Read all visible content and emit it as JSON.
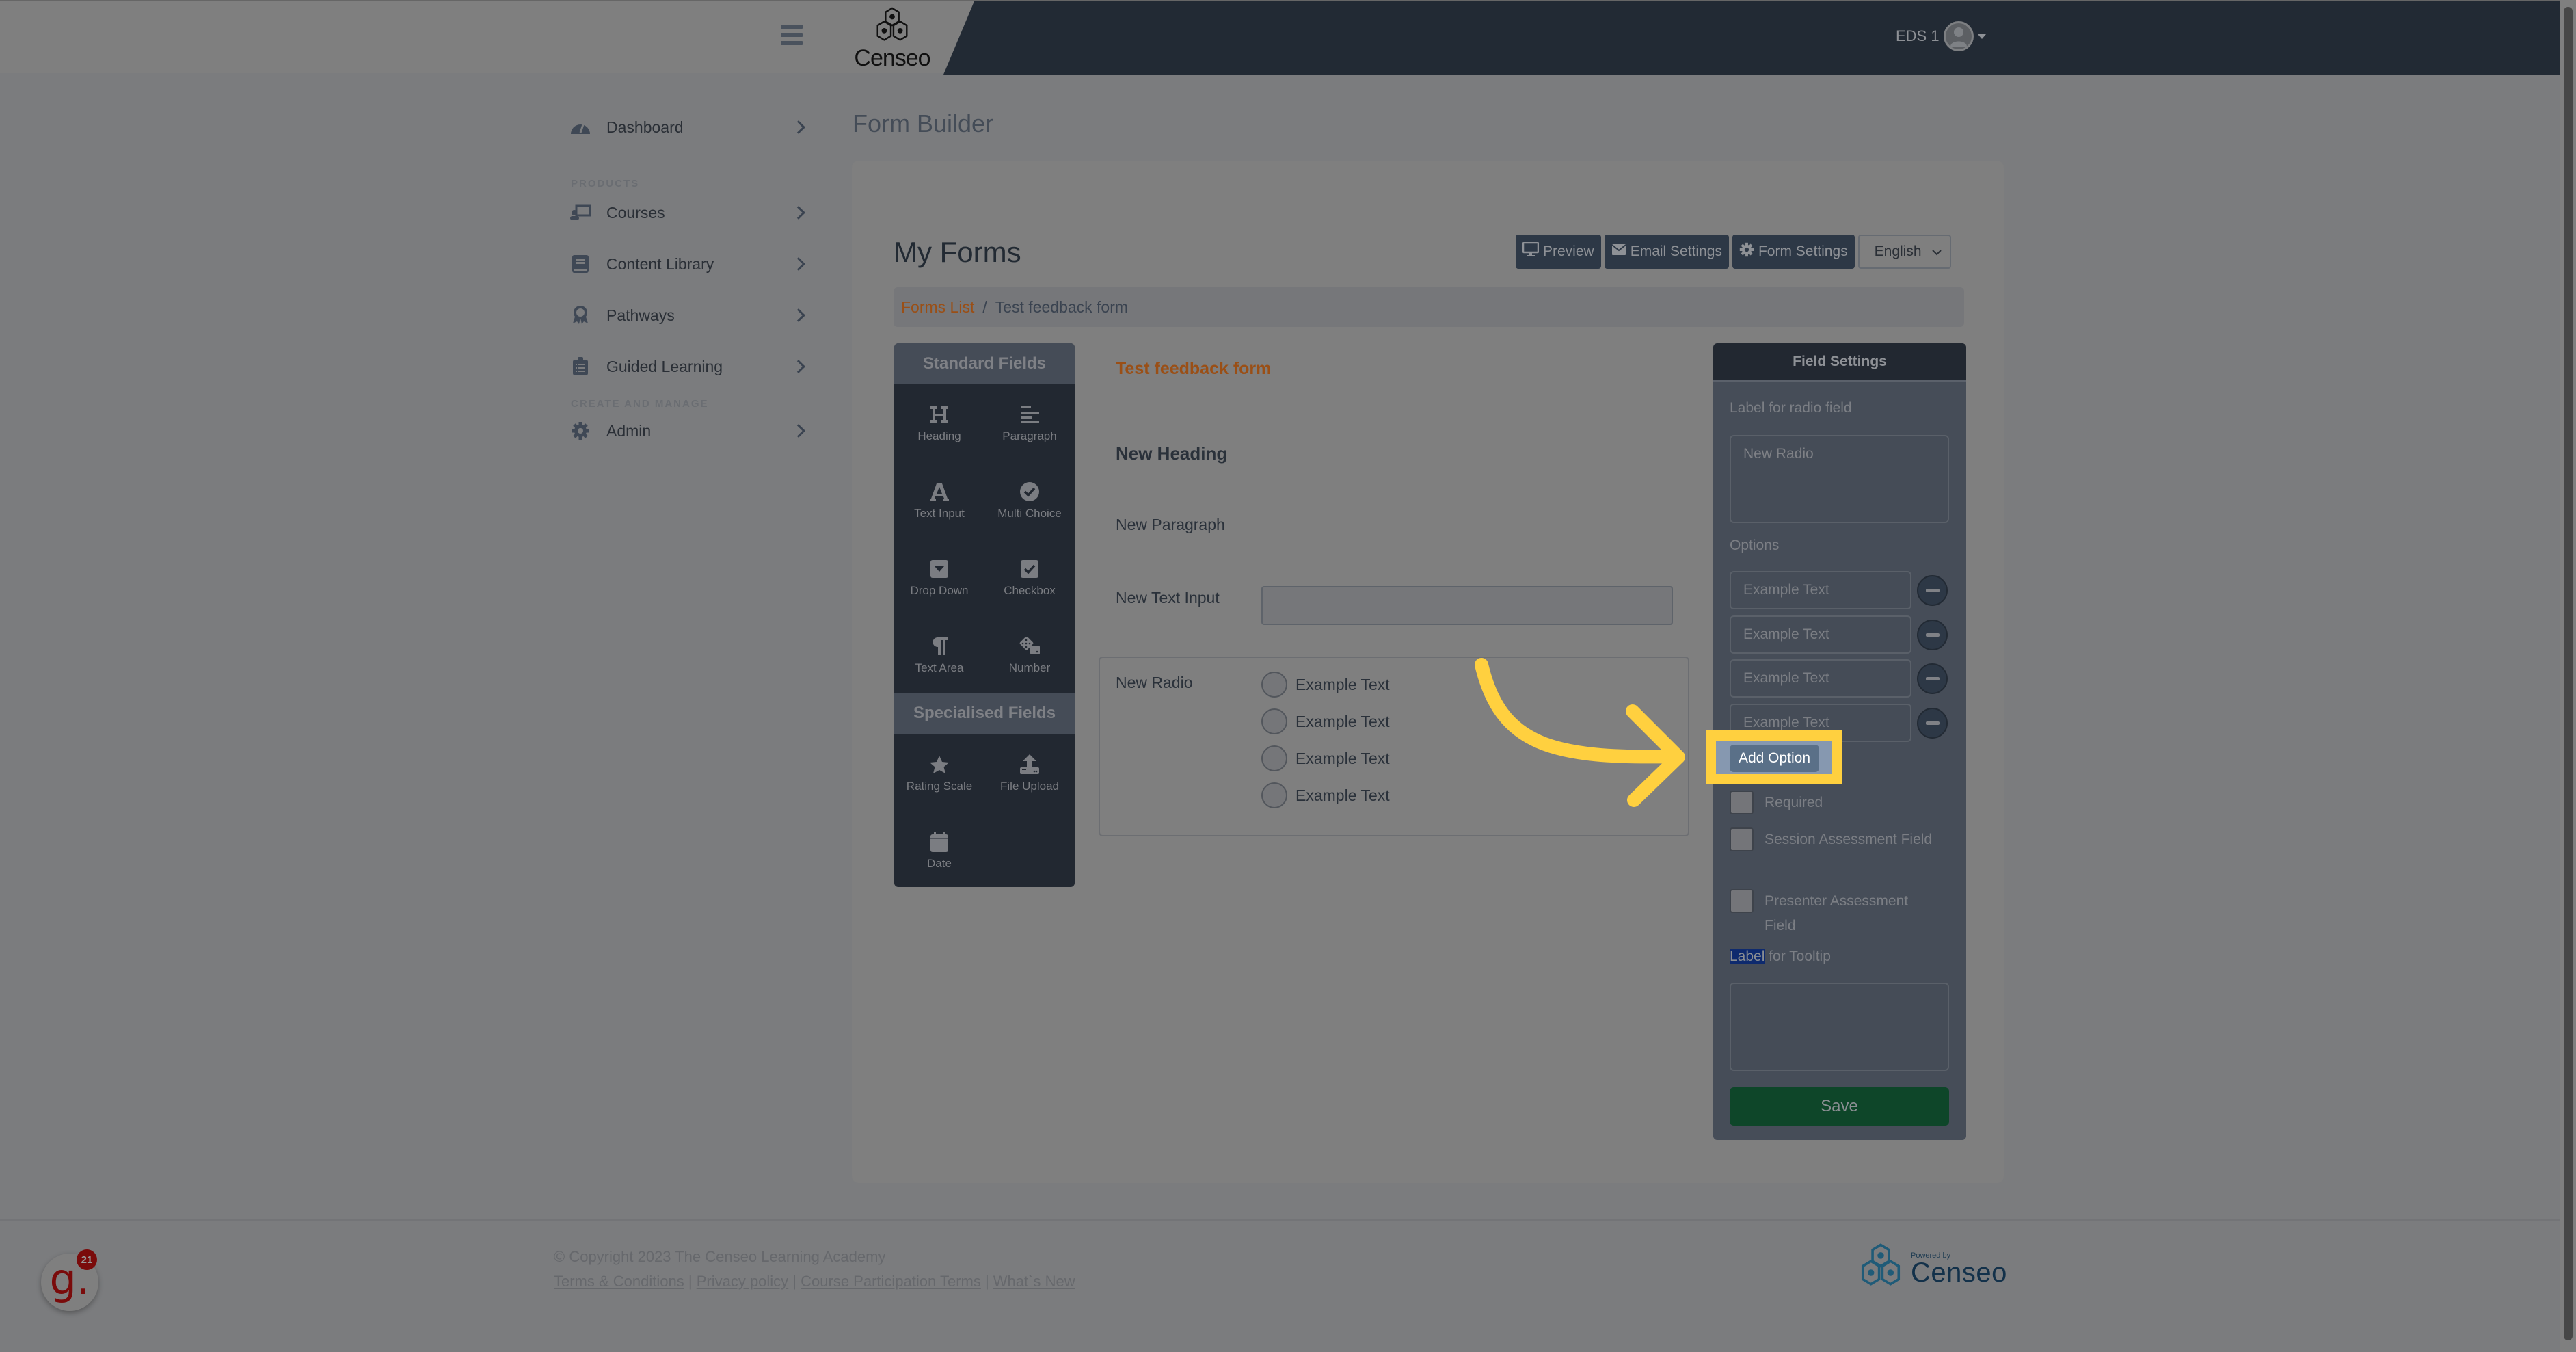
{
  "topbar": {
    "menu_icon": "hamburger-icon",
    "logo_text": "Censeo",
    "user_name": "EDS 1",
    "avatar_icon": "user-circle-icon"
  },
  "sidebar": {
    "items": [
      {
        "label": "Dashboard",
        "icon": "gauge-icon"
      },
      {
        "label": "Courses",
        "icon": "chalkboard-teacher-icon"
      },
      {
        "label": "Content Library",
        "icon": "book-icon"
      },
      {
        "label": "Pathways",
        "icon": "award-icon"
      },
      {
        "label": "Guided Learning",
        "icon": "clipboard-list-icon"
      },
      {
        "label": "Admin",
        "icon": "gear-icon"
      }
    ],
    "sections": {
      "products": "PRODUCTS",
      "create_manage": "CREATE AND MANAGE"
    }
  },
  "page": {
    "title": "Form Builder",
    "heading": "My Forms",
    "toolbar": {
      "preview": "Preview",
      "email_settings": "Email Settings",
      "form_settings": "Form Settings",
      "language": "English"
    },
    "breadcrumb": {
      "link": "Forms List",
      "separator": "/",
      "current": "Test feedback form"
    }
  },
  "palette": {
    "standard_header": "Standard Fields",
    "standard": [
      {
        "label": "Heading",
        "icon": "heading-icon"
      },
      {
        "label": "Paragraph",
        "icon": "align-left-icon"
      },
      {
        "label": "Text Input",
        "icon": "font-icon"
      },
      {
        "label": "Multi Choice",
        "icon": "check-circle-icon"
      },
      {
        "label": "Drop Down",
        "icon": "caret-square-down-icon"
      },
      {
        "label": "Checkbox",
        "icon": "check-square-icon"
      },
      {
        "label": "Text Area",
        "icon": "paragraph-icon"
      },
      {
        "label": "Number",
        "icon": "dice-icon"
      }
    ],
    "specialised_header": "Specialised Fields",
    "specialised": [
      {
        "label": "Rating Scale",
        "icon": "star-icon"
      },
      {
        "label": "File Upload",
        "icon": "upload-icon"
      },
      {
        "label": "Date",
        "icon": "calendar-icon"
      }
    ]
  },
  "form": {
    "title": "Test feedback form",
    "heading": "New Heading",
    "paragraph": "New Paragraph",
    "text_input_label": "New Text Input",
    "radio_label": "New Radio",
    "radio_options": [
      "Example Text",
      "Example Text",
      "Example Text",
      "Example Text"
    ]
  },
  "field_settings": {
    "header": "Field Settings",
    "label_caption": "Label for radio field",
    "label_value": "New Radio",
    "options_caption": "Options",
    "options": [
      "Example Text",
      "Example Text",
      "Example Text",
      "Example Text"
    ],
    "add_option": "Add Option",
    "checkboxes": [
      {
        "label": "Required",
        "checked": false
      },
      {
        "label": "Session Assessment Field",
        "checked": false
      },
      {
        "label": "Presenter Assessment Field",
        "checked": false
      }
    ],
    "tooltip_caption_selected": "Label",
    "tooltip_caption_rest": " for Tooltip",
    "tooltip_value": "",
    "save": "Save"
  },
  "footer": {
    "copyright": "© Copyright 2023 The Censeo Learning Academy",
    "links": [
      "Terms & Conditions",
      "Privacy policy",
      "Course Participation Terms",
      "What`s New"
    ],
    "separator": " | ",
    "powered_by_small": "Powered by",
    "powered_by_brand": "Censeo"
  },
  "widget": {
    "letter": "g.",
    "badge_count": "21"
  },
  "colors": {
    "accent_orange": "#9a4f16",
    "highlight_yellow": "#ffd03f",
    "save_green": "#0e4629",
    "navbar_dark": "#222a34"
  }
}
